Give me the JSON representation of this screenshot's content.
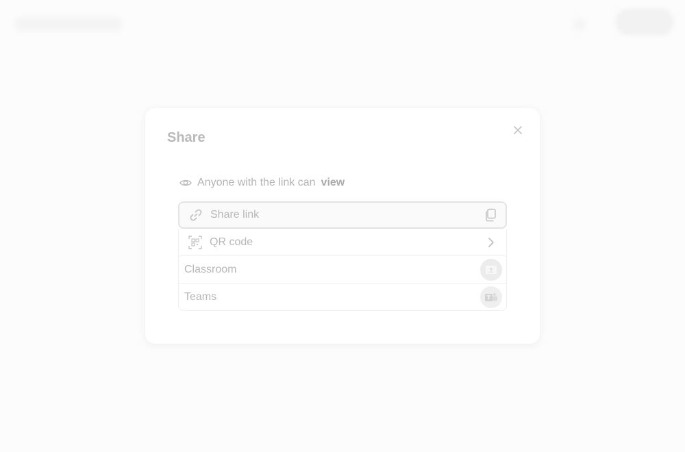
{
  "dialog": {
    "title": "Share",
    "close_icon": "close-icon",
    "access": {
      "icon": "eye-icon",
      "prefix": "Anyone with the link can",
      "permission": "view"
    },
    "options": [
      {
        "label": "Share link",
        "lead_icon": "link-icon",
        "trail_icon": "copy-icon"
      },
      {
        "label": "QR code",
        "lead_icon": "qr-code-icon",
        "trail_icon": "chevron-right-icon"
      },
      {
        "label": "Classroom",
        "trail_icon": "classroom-icon"
      },
      {
        "label": "Teams",
        "trail_icon": "teams-icon"
      }
    ]
  },
  "colors": {
    "text_faded": "#b6b6b6",
    "border": "#e3e3e3",
    "dialog_bg": "#ffffff",
    "backdrop": "#fcfcfc"
  }
}
